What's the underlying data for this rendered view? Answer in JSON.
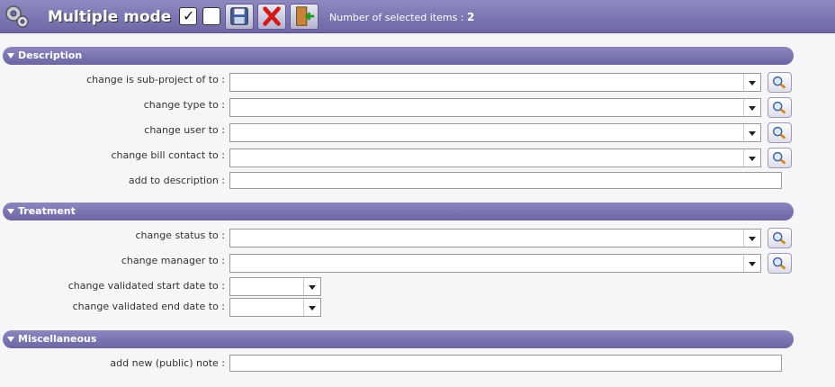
{
  "header": {
    "title": "Multiple mode",
    "selected_label": "Number of selected items : ",
    "selected_count": "2",
    "check_mark": "✓",
    "icons": [
      "gear-icon",
      "select-all-checkbox",
      "unselect-all-checkbox",
      "save-icon",
      "cancel-icon",
      "exit-icon"
    ]
  },
  "sections": {
    "description": {
      "title": "Description",
      "subproject_label": "change is sub-project of to :",
      "type_label": "change type to :",
      "user_label": "change user to :",
      "billcontact_label": "change bill contact to :",
      "adddesc_label": "add to description :"
    },
    "treatment": {
      "title": "Treatment",
      "status_label": "change status to :",
      "manager_label": "change manager to :",
      "startdate_label": "change validated start date to :",
      "enddate_label": "change validated end date to :"
    },
    "misc": {
      "title": "Miscellaneous",
      "note_label": "add new (public) note :"
    }
  },
  "colors": {
    "header_bg": "#7a75b3",
    "section_bg": "#7a75b3",
    "page_bg": "#f6f6f8"
  }
}
